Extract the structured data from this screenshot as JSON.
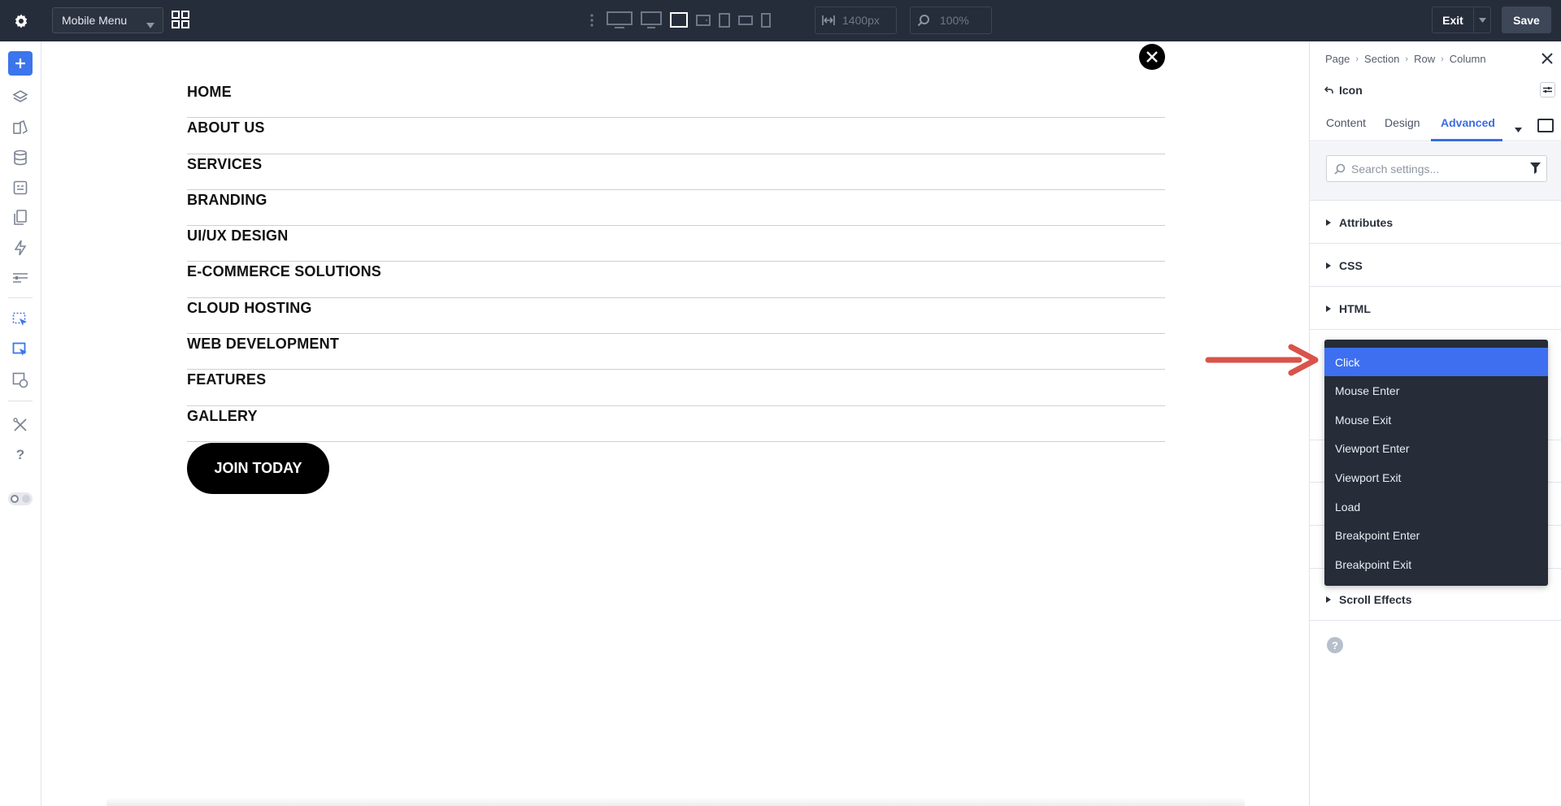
{
  "topbar": {
    "layout_select": "Mobile Menu",
    "width_value": "1400px",
    "zoom_value": "100%",
    "exit_label": "Exit",
    "save_label": "Save"
  },
  "canvas": {
    "menu_items": [
      "HOME",
      "ABOUT US",
      "SERVICES",
      "BRANDING",
      "UI/UX DESIGN",
      "E-COMMERCE SOLUTIONS",
      "CLOUD HOSTING",
      "WEB DEVELOPMENT",
      "FEATURES",
      "GALLERY"
    ],
    "cta_label": "JOIN TODAY"
  },
  "panel": {
    "breadcrumbs": [
      "Page",
      "Section",
      "Row",
      "Column"
    ],
    "title": "Icon",
    "tabs": [
      "Content",
      "Design",
      "Advanced"
    ],
    "active_tab": "Advanced",
    "search_placeholder": "Search settings...",
    "sections": [
      "Attributes",
      "CSS",
      "HTML",
      "Scroll Effects"
    ]
  },
  "dropdown": {
    "options": [
      "Click",
      "Mouse Enter",
      "Mouse Exit",
      "Viewport Enter",
      "Viewport Exit",
      "Load",
      "Breakpoint Enter",
      "Breakpoint Exit"
    ],
    "selected": "Click"
  },
  "colors": {
    "topbar_bg": "#262d3a",
    "accent": "#3b6de0",
    "dropdown_bg": "#262c38",
    "dropdown_selected": "#3d6ff0",
    "annotation_arrow": "#d9534a"
  }
}
